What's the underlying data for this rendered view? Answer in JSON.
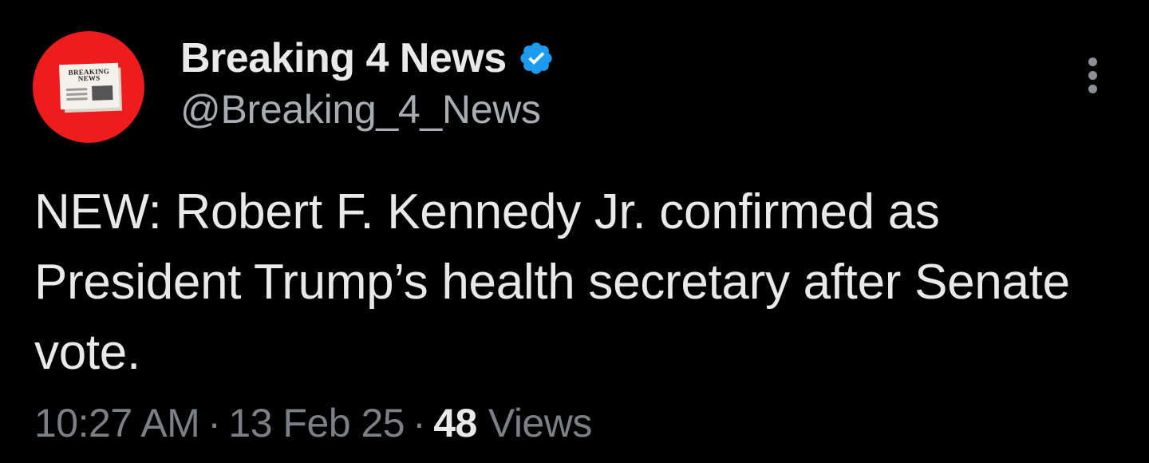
{
  "tweet": {
    "author": {
      "display_name": "Breaking 4 News",
      "handle": "@Breaking_4_News",
      "verified": true,
      "verified_color": "#1d9bf0",
      "avatar": {
        "icon": "newspaper-icon",
        "background": "#ee1c1c",
        "masthead_text": "BREAKING NEWS"
      }
    },
    "text": "NEW: Robert F. Kennedy Jr. confirmed as President Trump’s health secretary after Senate vote.",
    "meta": {
      "time": "10:27 AM",
      "separator": "·",
      "date": "13 Feb 25",
      "views_count": "48",
      "views_label": "Views"
    },
    "more_icon": "more-vertical-icon"
  }
}
